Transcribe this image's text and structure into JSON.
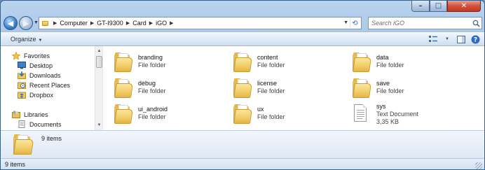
{
  "window": {
    "controls": {
      "minimize": "–",
      "maximize": "□",
      "close": "✕"
    }
  },
  "nav": {
    "back_icon": "back-arrow-icon",
    "forward_icon": "forward-arrow-icon"
  },
  "address": {
    "crumbs": [
      "Computer",
      "GT-I9300",
      "Card",
      "iGO"
    ]
  },
  "search": {
    "placeholder": "Search iGO"
  },
  "toolbar": {
    "organize_label": "Organize"
  },
  "sidebar": {
    "favorites_label": "Favorites",
    "items": [
      {
        "label": "Desktop",
        "icon": "desktop-icon"
      },
      {
        "label": "Downloads",
        "icon": "downloads-icon"
      },
      {
        "label": "Recent Places",
        "icon": "recent-places-icon"
      },
      {
        "label": "Dropbox",
        "icon": "dropbox-icon"
      }
    ],
    "libraries_label": "Libraries",
    "library_items": [
      {
        "label": "Documents",
        "icon": "documents-library-icon"
      }
    ]
  },
  "files": [
    {
      "name": "branding",
      "kind": "File folder",
      "type": "folder"
    },
    {
      "name": "content",
      "kind": "File folder",
      "type": "folder"
    },
    {
      "name": "data",
      "kind": "File folder",
      "type": "folder"
    },
    {
      "name": "debug",
      "kind": "File folder",
      "type": "folder"
    },
    {
      "name": "license",
      "kind": "File folder",
      "type": "folder"
    },
    {
      "name": "save",
      "kind": "File folder",
      "type": "folder"
    },
    {
      "name": "ui_android",
      "kind": "File folder",
      "type": "folder"
    },
    {
      "name": "ux",
      "kind": "File folder",
      "type": "folder"
    },
    {
      "name": "sys",
      "kind": "Text Document",
      "size": "3,35 KB",
      "type": "text"
    }
  ],
  "details": {
    "count": "9 items"
  },
  "status": {
    "text": "9 items"
  },
  "colors": {
    "chrome": "#b9d3ee",
    "folder": "#f2cf6a",
    "accent": "#3a7dc8"
  }
}
